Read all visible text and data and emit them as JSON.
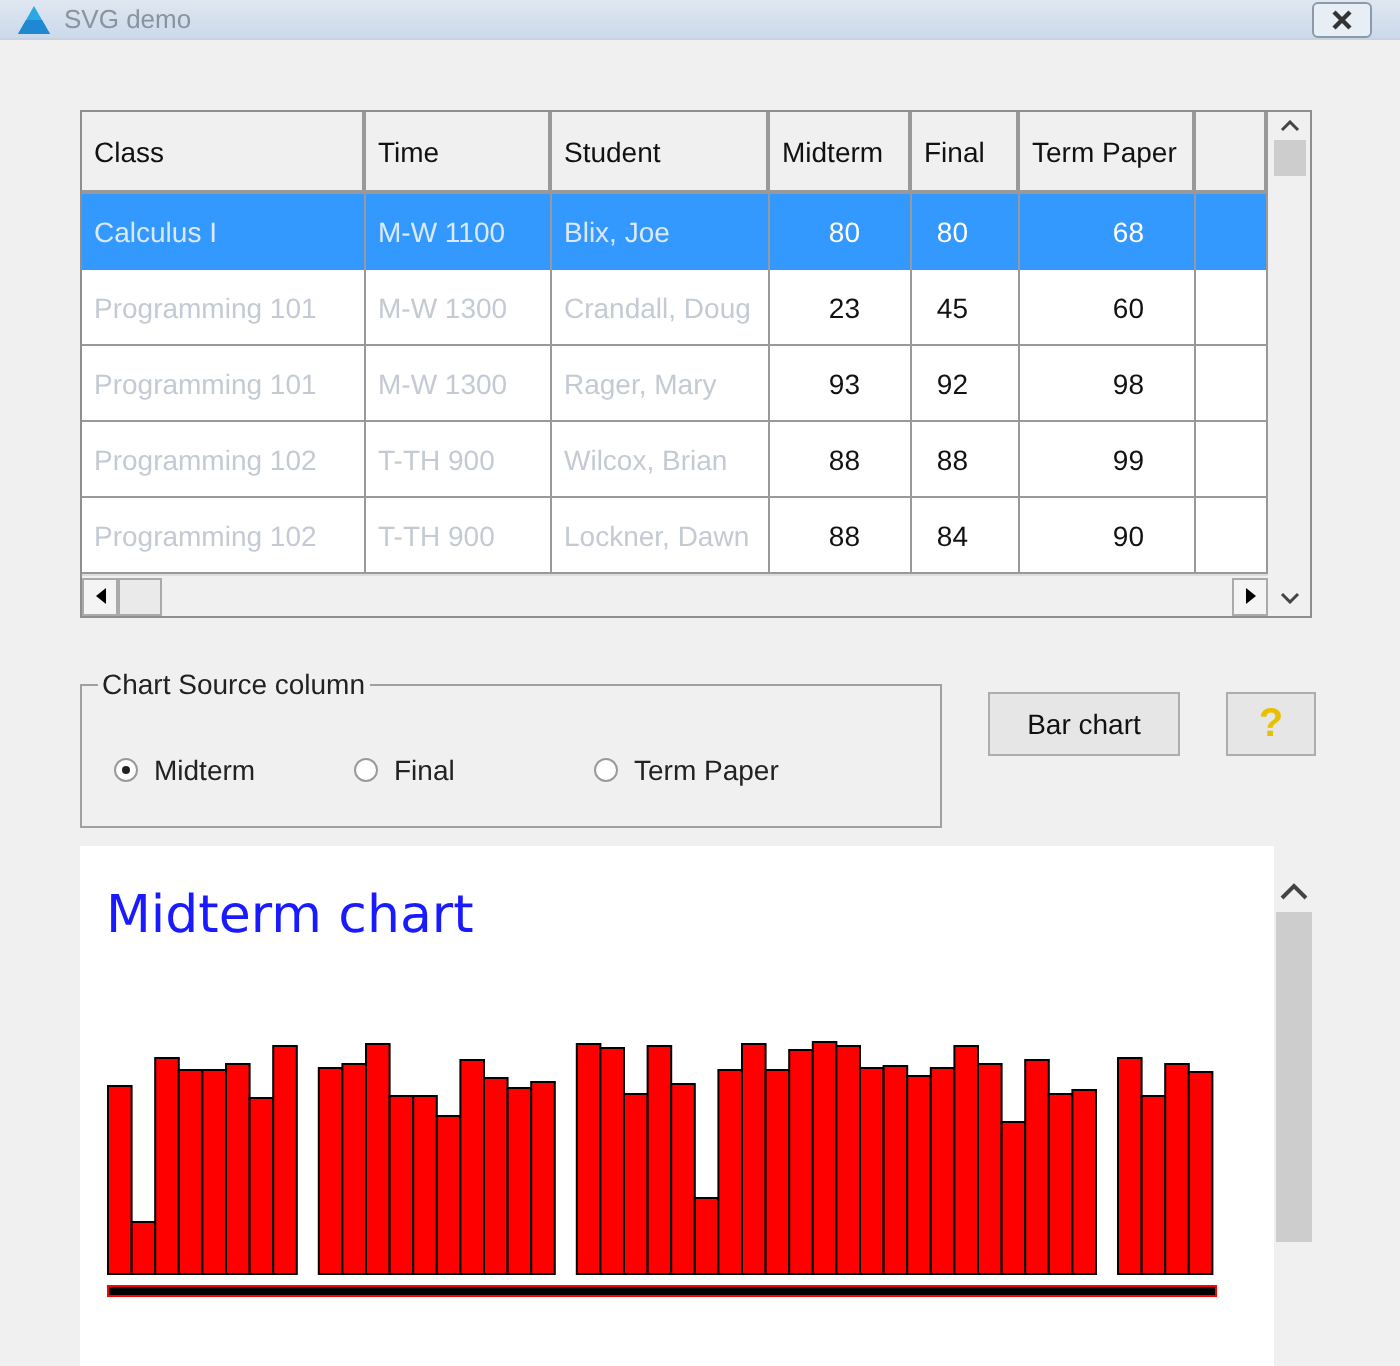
{
  "window": {
    "title": "SVG demo"
  },
  "table": {
    "columns": [
      {
        "label": "Class",
        "kind": "text"
      },
      {
        "label": "Time",
        "kind": "text"
      },
      {
        "label": "Student",
        "kind": "text"
      },
      {
        "label": "Midterm",
        "kind": "number"
      },
      {
        "label": "Final",
        "kind": "number"
      },
      {
        "label": "Term Paper",
        "kind": "number"
      }
    ],
    "rows": [
      {
        "selected": true,
        "cells": [
          "Calculus I",
          "M-W 1100",
          "Blix, Joe",
          "80",
          "80",
          "68"
        ]
      },
      {
        "selected": false,
        "cells": [
          "Programming 101",
          "M-W 1300",
          "Crandall, Doug",
          "23",
          "45",
          "60"
        ]
      },
      {
        "selected": false,
        "cells": [
          "Programming 101",
          "M-W 1300",
          "Rager, Mary",
          "93",
          "92",
          "98"
        ]
      },
      {
        "selected": false,
        "cells": [
          "Programming 102",
          "T-TH 900",
          "Wilcox, Brian",
          "88",
          "88",
          "99"
        ]
      },
      {
        "selected": false,
        "cells": [
          "Programming 102",
          "T-TH 900",
          "Lockner, Dawn",
          "88",
          "84",
          "90"
        ]
      }
    ]
  },
  "chart_source": {
    "legend": "Chart Source column",
    "options": [
      {
        "label": "Midterm",
        "selected": true
      },
      {
        "label": "Final",
        "selected": false
      },
      {
        "label": "Term Paper",
        "selected": false
      }
    ]
  },
  "buttons": [
    {
      "label": "Bar chart",
      "kind": "text"
    },
    {
      "label": "?",
      "kind": "help"
    }
  ],
  "chart": {
    "title": "Midterm chart"
  }
}
